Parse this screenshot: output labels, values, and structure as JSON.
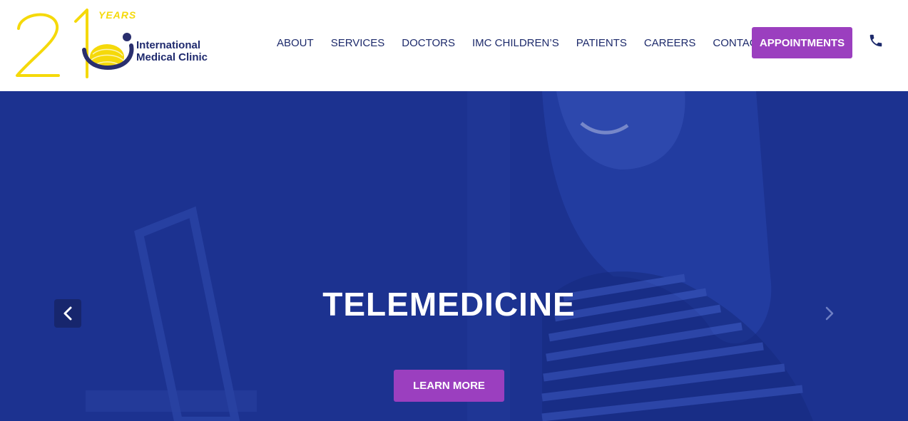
{
  "logo": {
    "anniversary_number": "21",
    "years_label": "YEARS",
    "name_line1": "International",
    "name_line2": "Medical Clinic"
  },
  "nav": {
    "items": [
      {
        "label": "ABOUT"
      },
      {
        "label": "SERVICES"
      },
      {
        "label": "DOCTORS"
      },
      {
        "label": "IMC CHILDREN’S"
      },
      {
        "label": "PATIENTS"
      },
      {
        "label": "CAREERS"
      },
      {
        "label": "CONTACT US"
      }
    ],
    "appointments_label": "APPOINTMENTS",
    "phone_icon": "phone-icon"
  },
  "hero": {
    "title": "TELEMEDICINE",
    "cta_label": "LEARN MORE",
    "prev_icon": "chevron-left-icon",
    "next_icon": "chevron-right-icon"
  },
  "colors": {
    "brand_navy": "#1d2a6b",
    "brand_purple": "#9b3fbf",
    "brand_yellow": "#f5d90a",
    "hero_overlay": "#1c3290"
  }
}
